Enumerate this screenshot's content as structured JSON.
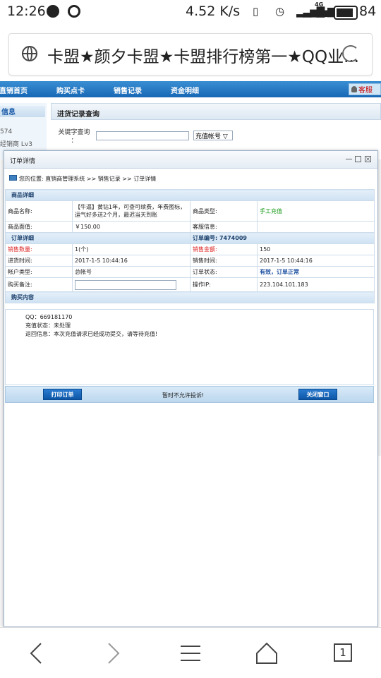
{
  "status_bar": {
    "time": "12:26",
    "net_speed": "4.52 K/s",
    "battery": "84",
    "signal_label": "4G"
  },
  "browser": {
    "url_title": "卡盟★颜夕卡盟★卡盟排行榜第一★QQ业..."
  },
  "site_nav": {
    "items": [
      "直销首页",
      "购买点卡",
      "销售记录",
      "资金明细"
    ],
    "service": "客服"
  },
  "left_col": {
    "header": "信息",
    "id_fragment": "574",
    "level": "经销商 Lv3"
  },
  "bg_panel": {
    "title": "进货记录查询",
    "keyword_label": "关键字查询 ：",
    "filter_select": "充值帐号"
  },
  "modal": {
    "title": "订单详情",
    "breadcrumb": "您的位置: 直销商管理系统 >> 销售记录 >> 订单详情",
    "product_section": "商品详细",
    "product_name_label": "商品名称:",
    "product_name_value": "【牛逼】黄钻1年，可查可续费，年费图标，运气好多送2个月，最迟当天到账",
    "product_type_label": "商品类型:",
    "product_type_value": "手工充值",
    "face_value_label": "商品面值:",
    "face_value_value": "￥150.00",
    "cs_label": "客服信息:",
    "cs_value": "",
    "order_section": "订单详细",
    "order_no_label": "订单编号: 7474009",
    "sale_qty_label": "销售数量:",
    "sale_qty_value": "1(个)",
    "sale_amount_label": "销售金额:",
    "sale_amount_value": "150",
    "purchase_time_label": "进货时间:",
    "purchase_time_value": "2017-1-5 10:44:16",
    "sale_time_label": "销售时间:",
    "sale_time_value": "2017-1-5 10:44:16",
    "account_type_label": "帐户类型:",
    "account_type_value": "总帐号",
    "order_status_label": "订单状态:",
    "order_status_value": "有效，订单正常",
    "remark_label": "购买备注:",
    "remark_value": "",
    "ip_label": "操作IP:",
    "ip_value": "223.104.101.183",
    "content_section": "购买内容",
    "content_qq": "QQ：669181170",
    "content_status": "充值状态：未处理",
    "content_return": "返回信息：本次充值请求已经成功提交，请等待充值!",
    "print_button": "打印订单",
    "no_complaint": "暂时不允许投诉!",
    "close_button": "关闭窗口"
  },
  "bottom_nav": {
    "tab_count": "1"
  },
  "colors": {
    "nav_blue": "#1767b5",
    "red_label": "#d22222",
    "green_value": "#1a9a1a",
    "status_blue": "#1a4ea0"
  }
}
